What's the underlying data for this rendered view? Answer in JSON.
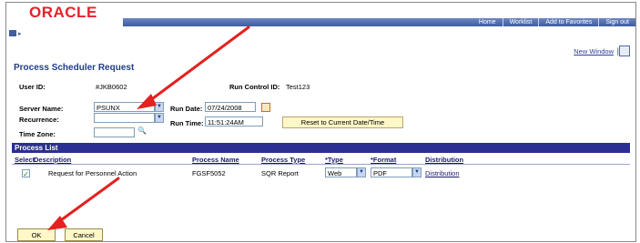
{
  "header": {
    "logo": "ORACLE",
    "nav": [
      "Home",
      "Worklist",
      "Add to Favorites",
      "Sign out"
    ],
    "new_window": "New Window",
    "separator": "|"
  },
  "page": {
    "title": "Process Scheduler Request",
    "user_id_label": "User ID:",
    "user_id_value": "#JKB0602",
    "run_control_label": "Run Control ID:",
    "run_control_value": "Test123",
    "server_name_label": "Server Name:",
    "server_name_value": "PSUNX",
    "recurrence_label": "Recurrence:",
    "recurrence_value": "",
    "time_zone_label": "Time Zone:",
    "time_zone_value": "",
    "run_date_label": "Run Date:",
    "run_date_value": "07/24/2008",
    "run_time_label": "Run Time:",
    "run_time_value": "11:51:24AM",
    "reset_label": "Reset to Current Date/Time"
  },
  "process_list": {
    "title": "Process List",
    "columns": [
      "Select",
      "Description",
      "Process Name",
      "Process Type",
      "*Type",
      "*Format",
      "Distribution"
    ],
    "rows": [
      {
        "selected": "✓",
        "description": "Request for Personnel Action",
        "process_name": "FGSF5052",
        "process_type": "SQR Report",
        "type": "Web",
        "format": "PDF",
        "distribution": "Distribution"
      }
    ]
  },
  "buttons": {
    "ok": "OK",
    "cancel": "Cancel"
  },
  "colors": {
    "brand": "#e8202a",
    "accent": "#2b2f8f",
    "arrow": "#e3211f"
  }
}
